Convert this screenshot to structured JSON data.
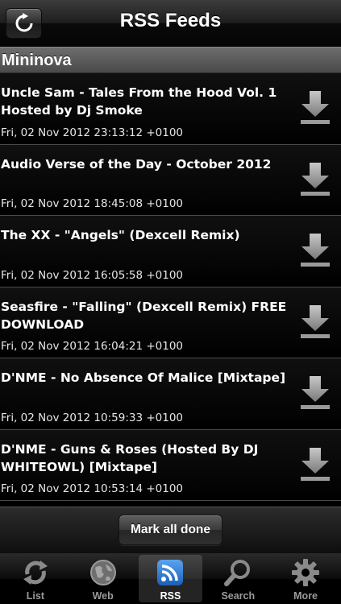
{
  "navbar": {
    "title": "RSS Feeds",
    "refresh_icon": "refresh-icon"
  },
  "section": {
    "title": "Mininova"
  },
  "feeds": [
    {
      "title": "Uncle Sam - Tales From the Hood Vol. 1 Hosted by Dj Smoke",
      "date": "Fri, 02 Nov 2012 23:13:12 +0100"
    },
    {
      "title": "Audio Verse of the Day - October 2012",
      "date": "Fri, 02 Nov 2012 18:45:08 +0100"
    },
    {
      "title": "The XX - \"Angels\" (Dexcell Remix)",
      "date": "Fri, 02 Nov 2012 16:05:58 +0100"
    },
    {
      "title": "Seasfire - \"Falling\" (Dexcell Remix) FREE DOWNLOAD",
      "date": "Fri, 02 Nov 2012 16:04:21 +0100"
    },
    {
      "title": "D'NME - No Absence Of Malice [Mixtape]",
      "date": "Fri, 02 Nov 2012 10:59:33 +0100"
    },
    {
      "title": "D'NME - Guns & Roses (Hosted By DJ WHITEOWL) [Mixtape]",
      "date": "Fri, 02 Nov 2012 10:53:14 +0100"
    }
  ],
  "actions": {
    "mark_all_done": "Mark all done"
  },
  "tabs": [
    {
      "label": "List",
      "icon": "sync-icon",
      "active": false
    },
    {
      "label": "Web",
      "icon": "globe-icon",
      "active": false
    },
    {
      "label": "RSS",
      "icon": "rss-icon",
      "active": true
    },
    {
      "label": "Search",
      "icon": "magnifier-icon",
      "active": false
    },
    {
      "label": "More",
      "icon": "gear-icon",
      "active": false
    }
  ],
  "colors": {
    "rss_accent": "#2f7fd8",
    "background": "#000000"
  }
}
